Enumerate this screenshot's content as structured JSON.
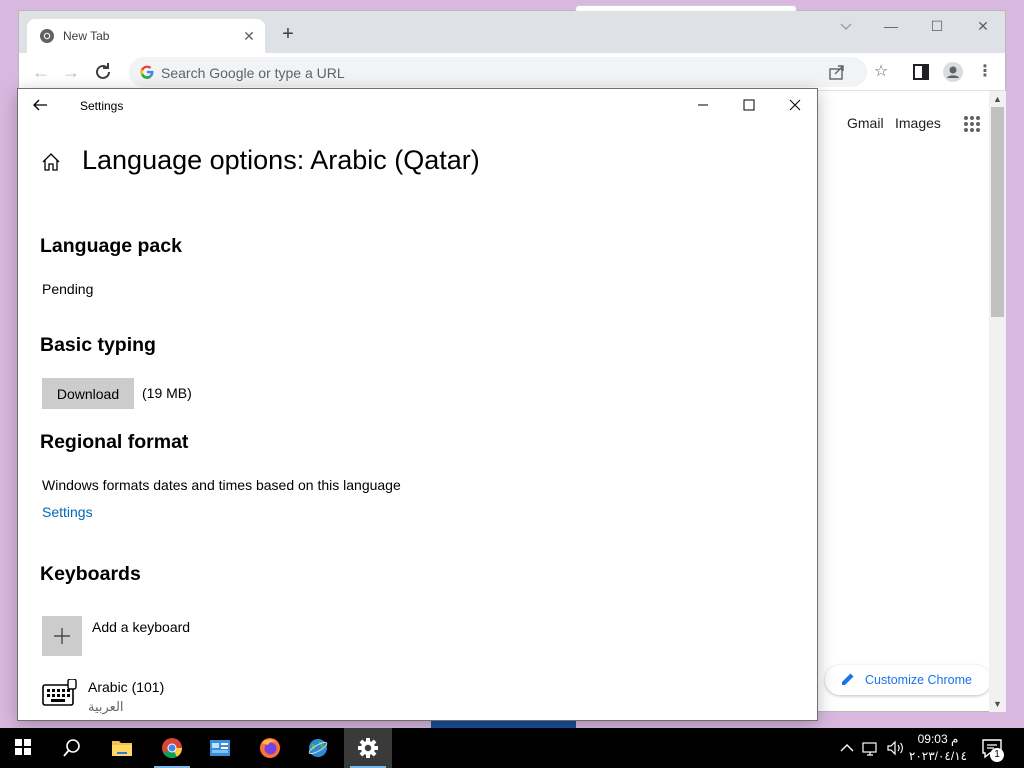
{
  "chrome": {
    "tab_title": "New Tab",
    "tab_close": "✕",
    "new_tab": "+",
    "omnibox_placeholder": "Search Google or type a URL",
    "ntp_links": {
      "gmail": "Gmail",
      "images": "Images"
    },
    "customize_label": "Customize Chrome",
    "window_controls": {
      "minimize": "—",
      "maximize": "☐",
      "close": "✕"
    }
  },
  "settings": {
    "window_title": "Settings",
    "page_title": "Language options: Arabic (Qatar)",
    "language_pack": {
      "heading": "Language pack",
      "status": "Pending"
    },
    "basic_typing": {
      "heading": "Basic typing",
      "download_label": "Download",
      "size": "(19 MB)"
    },
    "regional_format": {
      "heading": "Regional format",
      "description": "Windows formats dates and times based on this language",
      "link": "Settings"
    },
    "keyboards": {
      "heading": "Keyboards",
      "add_label": "Add a keyboard",
      "items": [
        {
          "name": "Arabic (101)",
          "native": "العربية"
        }
      ]
    }
  },
  "taskbar": {
    "time": "09:03 م",
    "date": "٢٠٢٣/٠٤/١٤",
    "notification_count": "1"
  },
  "colors": {
    "accent_link": "#0067b8",
    "taskbar": "#000000",
    "chrome_link": "#1a73e8",
    "desktop": "#d9b8df"
  }
}
